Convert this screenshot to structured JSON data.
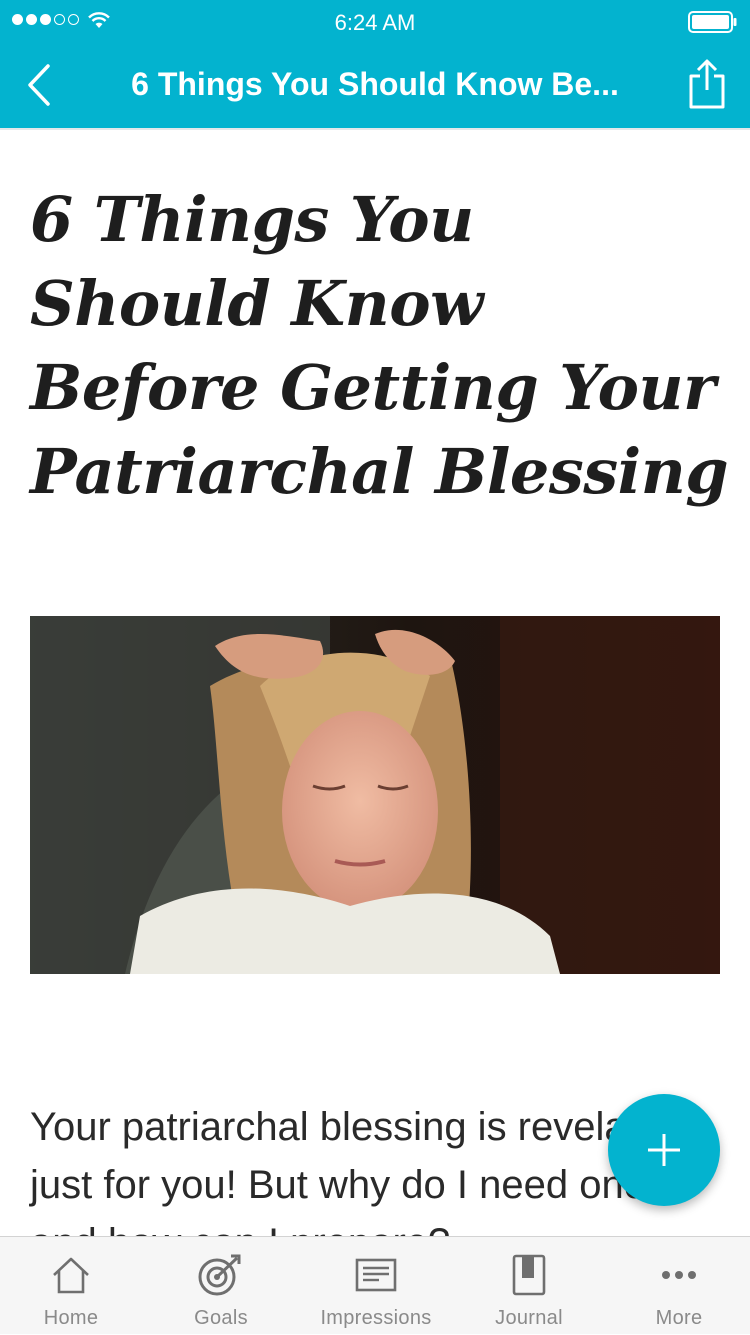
{
  "status_bar": {
    "time": "6:24 AM",
    "signal_bars_filled": 3,
    "signal_bars_total": 5,
    "wifi_icon": "wifi-icon",
    "battery_icon": "battery-icon"
  },
  "navbar": {
    "title": "6 Things You Should Know Be...",
    "back_icon": "chevron-left-icon",
    "share_icon": "share-icon"
  },
  "article": {
    "title": "6 Things You Should Know Before Getting Your Patriarchal Blessing",
    "body": "Your patriarchal blessing is revelation just for you! But why do I need one and how can I prepare?"
  },
  "fab": {
    "icon": "plus-icon"
  },
  "tabbar": {
    "items": [
      {
        "label": "Home",
        "icon": "home-icon"
      },
      {
        "label": "Goals",
        "icon": "target-icon"
      },
      {
        "label": "Impressions",
        "icon": "note-icon"
      },
      {
        "label": "Journal",
        "icon": "journal-icon"
      },
      {
        "label": "More",
        "icon": "more-icon"
      }
    ]
  },
  "colors": {
    "brand": "#03b3cf",
    "tab_label": "#8a8a8a",
    "title_text": "#1e1e1e"
  }
}
